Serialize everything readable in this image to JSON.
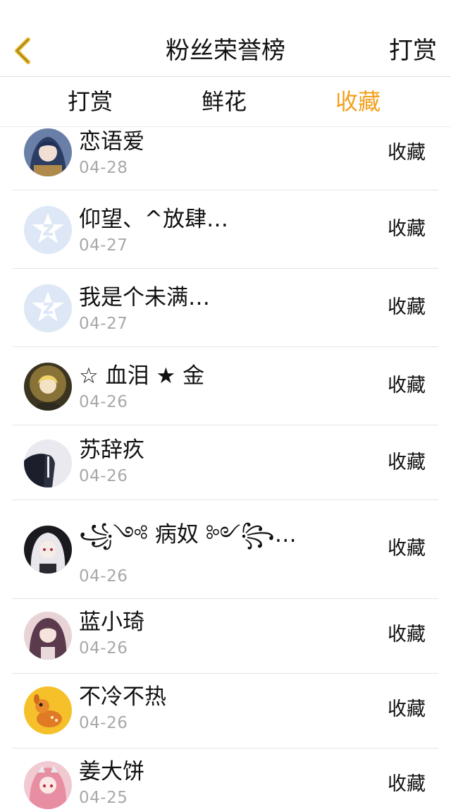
{
  "header": {
    "title": "粉丝荣誉榜",
    "action_label": "打赏"
  },
  "tabs": [
    {
      "label": "打赏",
      "active": false
    },
    {
      "label": "鲜花",
      "active": false
    },
    {
      "label": "收藏",
      "active": true
    }
  ],
  "colors": {
    "accent": "#f2a01d",
    "date_gray": "#a8a8a8",
    "default_avatar": "#dde7f5"
  },
  "rows": [
    {
      "name": "恋语爱",
      "date": "04-28",
      "action": "收藏",
      "avatar": "anime-avatar-blue"
    },
    {
      "name": "仰望、^放肆…",
      "date": "04-27",
      "action": "收藏",
      "avatar": "default-qq-avatar"
    },
    {
      "name": "我是个未满…",
      "date": "04-27",
      "action": "收藏",
      "avatar": "default-qq-avatar"
    },
    {
      "name": "☆ 血泪 ★ 金",
      "date": "04-26",
      "action": "收藏",
      "avatar": "anime-avatar-gold"
    },
    {
      "name": "苏辞疚",
      "date": "04-26",
      "action": "收藏",
      "avatar": "suit-avatar"
    },
    {
      "name": "꧁༺ 病奴 ༻꧂…",
      "date": "04-26",
      "action": "收藏",
      "avatar": "anime-avatar-white-hair"
    },
    {
      "name": "蓝小琦",
      "date": "04-26",
      "action": "收藏",
      "avatar": "anime-avatar-purple"
    },
    {
      "name": "不冷不热",
      "date": "04-26",
      "action": "收藏",
      "avatar": "fawn-avatar"
    },
    {
      "name": "姜大饼",
      "date": "04-25",
      "action": "收藏",
      "avatar": "anime-avatar-pink"
    }
  ]
}
